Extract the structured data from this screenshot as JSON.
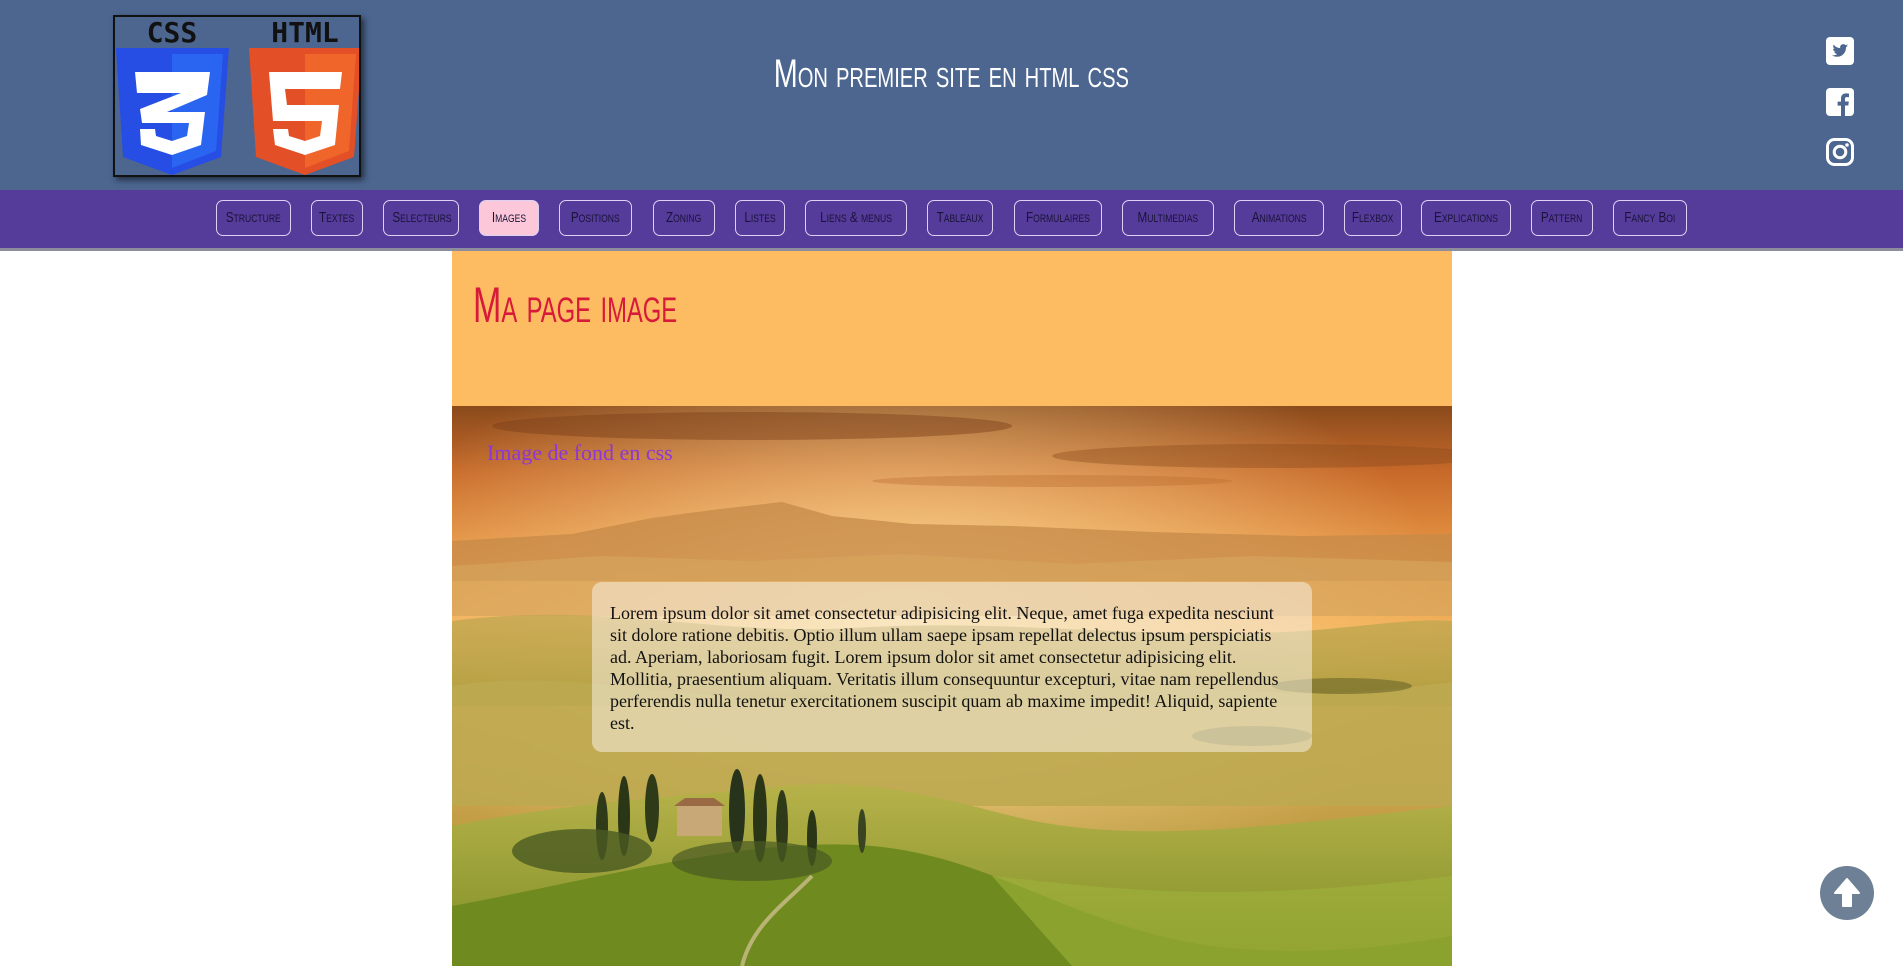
{
  "header": {
    "title": "Mon premier site en html css",
    "logo": {
      "css_text": "CSS",
      "html_text": "HTML",
      "css_digit": "3",
      "html_digit": "5"
    },
    "social": [
      {
        "name": "twitter-icon"
      },
      {
        "name": "facebook-icon"
      },
      {
        "name": "instagram-icon"
      }
    ]
  },
  "nav": {
    "items": [
      {
        "label": "Structure"
      },
      {
        "label": "Textes"
      },
      {
        "label": "Selecteurs"
      },
      {
        "label": "Images",
        "active": true
      },
      {
        "label": "Positions"
      },
      {
        "label": "Zoning"
      },
      {
        "label": "Listes"
      },
      {
        "label": "Liens & menus"
      },
      {
        "label": "Tableaux"
      },
      {
        "label": "Formulaires"
      },
      {
        "label": "Multimedias"
      },
      {
        "label": "Animations"
      },
      {
        "label": "Flexbox"
      },
      {
        "label": "Explications"
      },
      {
        "label": "Pattern"
      },
      {
        "label": "Fancy Boi"
      }
    ]
  },
  "main": {
    "page_title": "Ma page image",
    "bg_caption": "Image de fond en css",
    "paragraph": "Lorem ipsum dolor sit amet consectetur adipisicing elit. Neque, amet fuga expedita nesciunt sit dolore ratione debitis. Optio illum ullam saepe ipsam repellat delectus ipsum perspiciatis ad. Aperiam, laboriosam fugit. Lorem ipsum dolor sit amet consectetur adipisicing elit. Mollitia, praesentium aliquam. Veritatis illum consequuntur excepturi, vitae nam repellendus perferendis nulla tenetur exercitationem suscipit quam ab maxime impedit! Aliquid, sapiente est."
  },
  "scroll_top": {
    "icon": "arrow-up-icon"
  },
  "colors": {
    "header_bg": "#4c6690",
    "nav_bg": "#553b9a",
    "nav_active": "#fbc7d9",
    "title_band": "#fdbb62",
    "page_title": "#d71a3a",
    "caption": "#8d36d9"
  }
}
